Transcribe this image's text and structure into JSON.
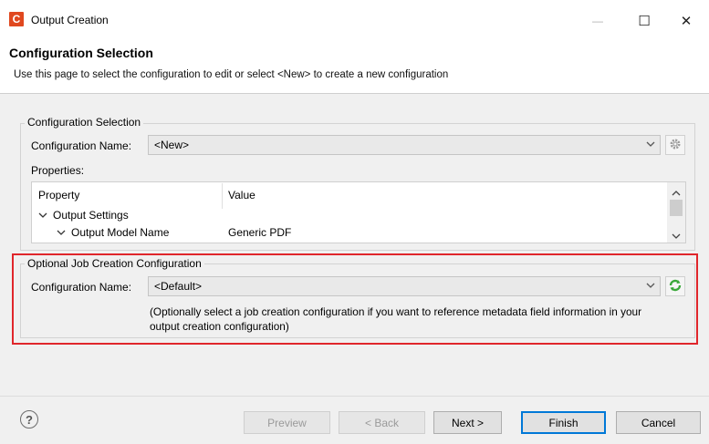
{
  "window": {
    "app_icon_letter": "C",
    "title": "Output Creation",
    "minimize": "—",
    "maximize": "☐",
    "close": "✕"
  },
  "header": {
    "title": "Configuration Selection",
    "description": "Use this page to select the configuration to edit or select <New> to create a new configuration"
  },
  "configuration_selection": {
    "legend": "Configuration Selection",
    "name_label": "Configuration Name:",
    "name_value": "<New>",
    "properties_label": "Properties:",
    "table": {
      "headers": [
        "Property",
        "Value"
      ],
      "rows": [
        {
          "property": "Output Settings",
          "value": ""
        },
        {
          "property": "Output Model Name",
          "value": "Generic PDF"
        }
      ]
    }
  },
  "optional_job": {
    "legend": "Optional Job Creation Configuration",
    "name_label": "Configuration Name:",
    "name_value": "<Default>",
    "hint_line1": "(Optionally select a job creation configuration if you want to reference metadata field information in your",
    "hint_line2": "output creation configuration)"
  },
  "footer": {
    "help": "?",
    "preview": "Preview",
    "back": "< Back",
    "next": "Next >",
    "finish": "Finish",
    "cancel": "Cancel"
  },
  "colors": {
    "highlight_border": "#e0262b",
    "app_icon": "#e0481f",
    "default_button_border": "#0078d7"
  }
}
